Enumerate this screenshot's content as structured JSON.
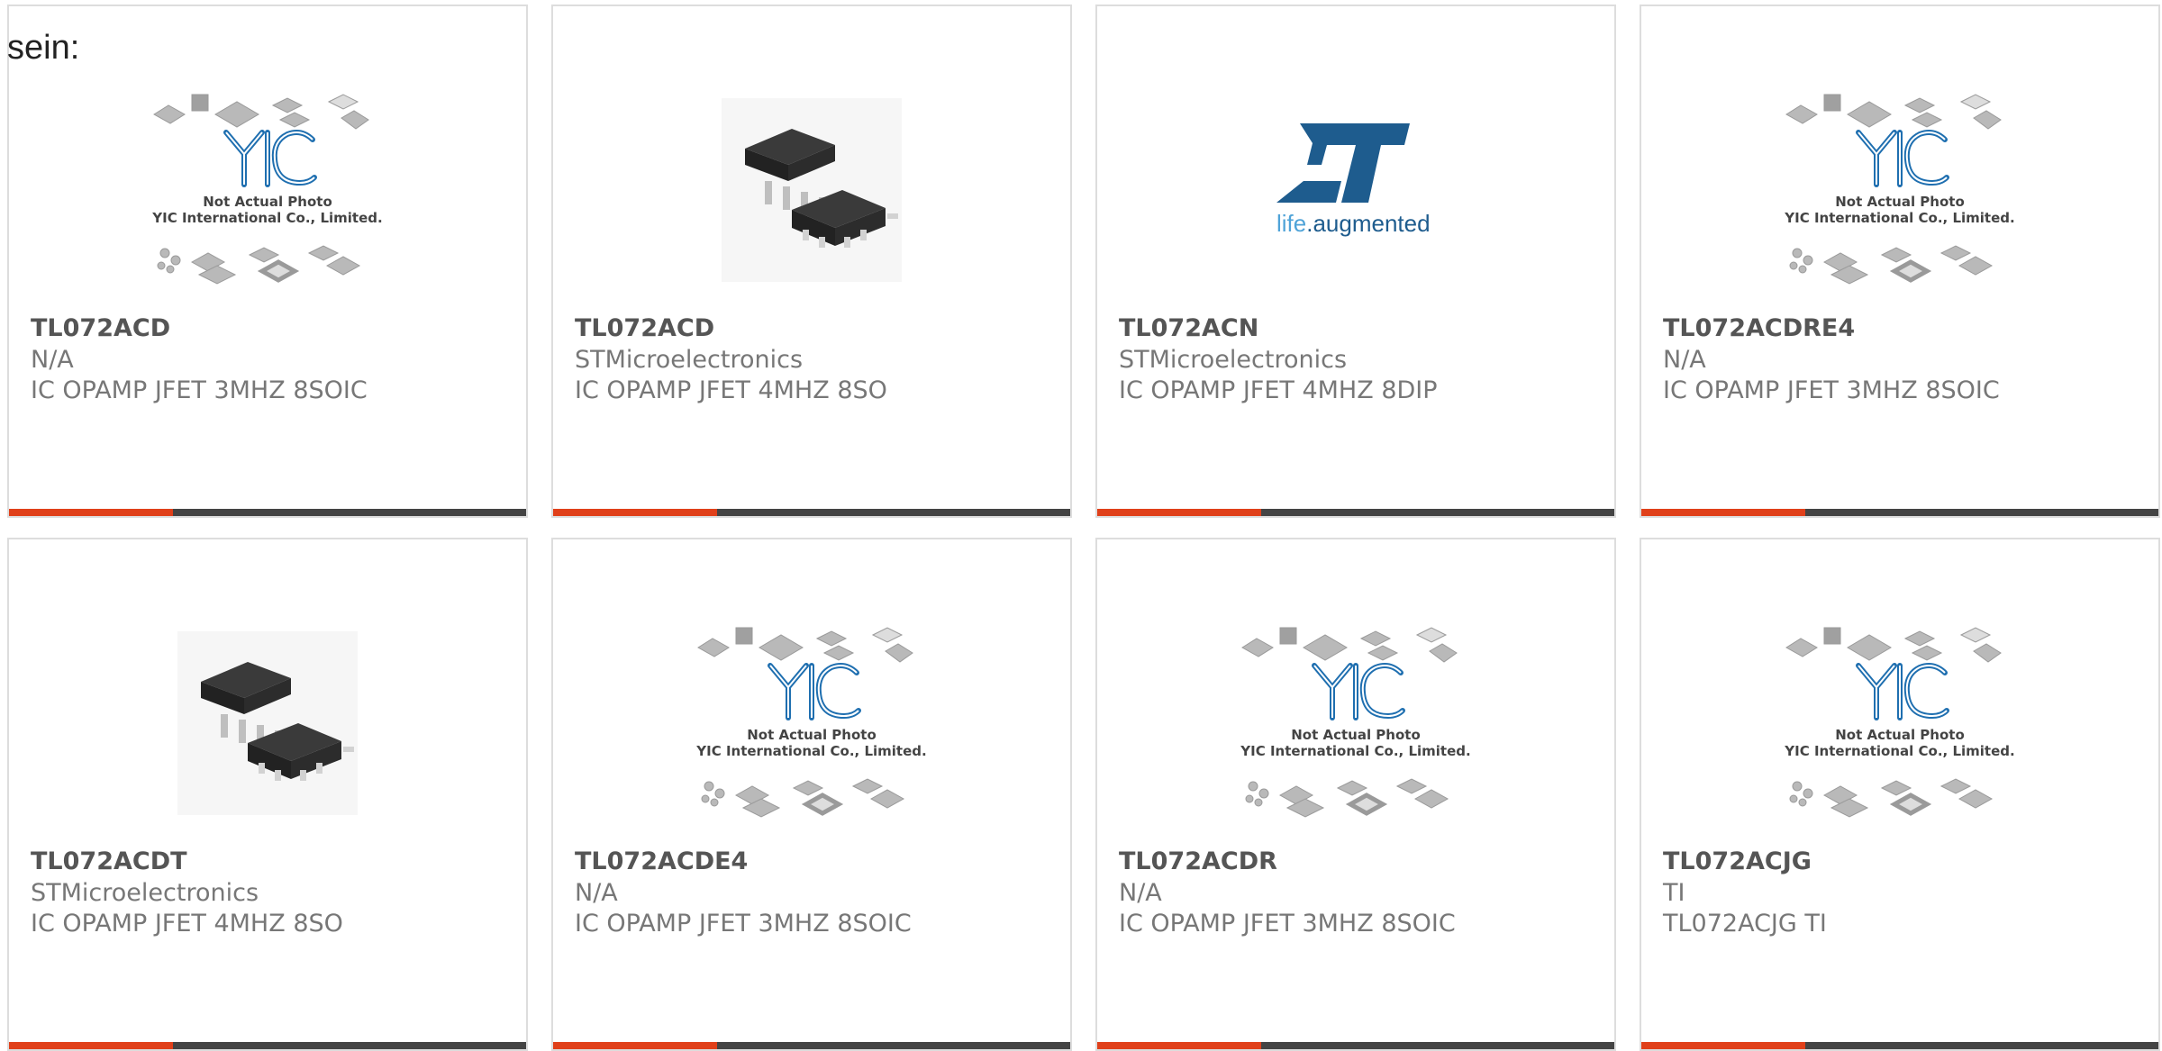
{
  "intro_text": "sein:",
  "placeholder_caption": {
    "line1": "Not Actual Photo",
    "line2": "YIC International Co., Limited."
  },
  "st_logo": {
    "tagline_life": "life",
    "tagline_aug": ".augmented"
  },
  "colors": {
    "accent_bar": "#e0401a",
    "dark_bar": "#444444",
    "yic_blue": "#1f6fb0",
    "st_blue": "#1e5c8e"
  },
  "products": [
    {
      "part": "TL072ACD",
      "manufacturer": "N/A",
      "description": "IC OPAMP JFET 3MHZ 8SOIC",
      "image": "yic-placeholder"
    },
    {
      "part": "TL072ACD",
      "manufacturer": "STMicroelectronics",
      "description": "IC OPAMP JFET 4MHZ 8SO",
      "image": "soic-chip-photo"
    },
    {
      "part": "TL072ACN",
      "manufacturer": "STMicroelectronics",
      "description": "IC OPAMP JFET 4MHZ 8DIP",
      "image": "st-logo"
    },
    {
      "part": "TL072ACDRE4",
      "manufacturer": "N/A",
      "description": "IC OPAMP JFET 3MHZ 8SOIC",
      "image": "yic-placeholder"
    },
    {
      "part": "TL072ACDT",
      "manufacturer": "STMicroelectronics",
      "description": "IC OPAMP JFET 4MHZ 8SO",
      "image": "soic-chip-photo"
    },
    {
      "part": "TL072ACDE4",
      "manufacturer": "N/A",
      "description": "IC OPAMP JFET 3MHZ 8SOIC",
      "image": "yic-placeholder"
    },
    {
      "part": "TL072ACDR",
      "manufacturer": "N/A",
      "description": "IC OPAMP JFET 3MHZ 8SOIC",
      "image": "yic-placeholder"
    },
    {
      "part": "TL072ACJG",
      "manufacturer": "TI",
      "description": "TL072ACJG TI",
      "image": "yic-placeholder"
    }
  ]
}
